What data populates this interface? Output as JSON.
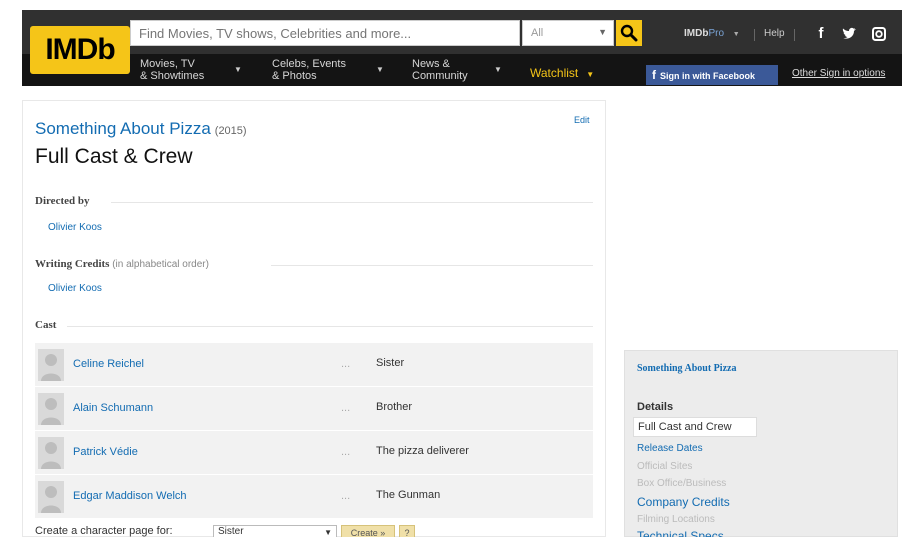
{
  "header": {
    "logo": "IMDb",
    "search_placeholder": "Find Movies, TV shows, Celebrities and more...",
    "search_category": "All",
    "imdbpro": {
      "brand": "IMDb",
      "pro": "Pro"
    },
    "help": "Help",
    "nav": [
      {
        "line1": "Movies, TV",
        "line2": "& Showtimes"
      },
      {
        "line1": "Celebs, Events",
        "line2": "& Photos"
      },
      {
        "line1": "News &",
        "line2": "Community"
      }
    ],
    "watchlist": "Watchlist",
    "facebook_signin": "Sign in with Facebook",
    "other_signin": "Other Sign in options"
  },
  "main": {
    "title": "Something About Pizza",
    "year": "(2015)",
    "edit": "Edit",
    "page_title": "Full Cast & Crew",
    "directed_by": {
      "heading": "Directed by",
      "people": [
        "Olivier Koos"
      ]
    },
    "writing": {
      "heading": "Writing Credits",
      "note": "(in alphabetical order)",
      "people": [
        "Olivier Koos"
      ]
    },
    "cast": {
      "heading": "Cast",
      "rows": [
        {
          "actor": "Celine Reichel",
          "dots": "...",
          "character": "Sister"
        },
        {
          "actor": "Alain Schumann",
          "dots": "...",
          "character": "Brother"
        },
        {
          "actor": "Patrick Védie",
          "dots": "...",
          "character": "The pizza deliverer"
        },
        {
          "actor": "Edgar Maddison Welch",
          "dots": "...",
          "character": "The Gunman"
        }
      ]
    },
    "create_character": {
      "label": "Create a character page for:",
      "selected": "Sister",
      "button": "Create »",
      "help": "?"
    }
  },
  "sidebar": {
    "title": "Something About Pizza",
    "details_heading": "Details",
    "current": "Full Cast and Crew",
    "links": [
      {
        "label": "Release Dates",
        "dim": false
      },
      {
        "label": "Official Sites",
        "dim": true
      },
      {
        "label": "Box Office/Business",
        "dim": true
      },
      {
        "label": "Company Credits",
        "dim": false
      },
      {
        "label": "Filming Locations",
        "dim": true
      },
      {
        "label": "Technical Specs",
        "dim": false
      }
    ]
  }
}
